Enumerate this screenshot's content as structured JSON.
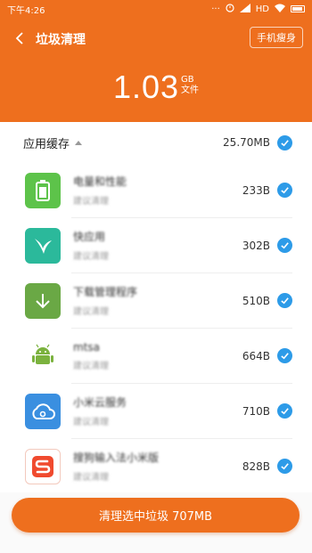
{
  "status_bar": {
    "time": "下午4:26",
    "network": "HD"
  },
  "header": {
    "title": "垃圾清理",
    "slim_button": "手机瘦身",
    "total_value": "1.03",
    "total_unit": "GB",
    "total_caption": "文件"
  },
  "section": {
    "label": "应用缓存",
    "size": "25.70MB"
  },
  "items": [
    {
      "name": "电量和性能",
      "sub": "建议清理",
      "size": "233B",
      "icon": "battery-icon",
      "color": "#5dc34a"
    },
    {
      "name": "快应用",
      "sub": "建议清理",
      "size": "302B",
      "icon": "bird-icon",
      "color": "#2bb99b"
    },
    {
      "name": "下载管理程序",
      "sub": "建议清理",
      "size": "510B",
      "icon": "download-icon",
      "color": "#6aa845"
    },
    {
      "name": "mtsa",
      "sub": "建议清理",
      "size": "664B",
      "icon": "android-icon",
      "color": "#ffffff"
    },
    {
      "name": "小米云服务",
      "sub": "建议清理",
      "size": "710B",
      "icon": "cloud-icon",
      "color": "#3a8fe0"
    },
    {
      "name": "搜狗输入法小米版",
      "sub": "建议清理",
      "size": "828B",
      "icon": "sogou-icon",
      "color": "#f04a2e"
    }
  ],
  "action": {
    "label": "清理选中垃圾 707MB"
  },
  "colors": {
    "accent": "#ee6f1e",
    "check": "#2d9be8"
  }
}
